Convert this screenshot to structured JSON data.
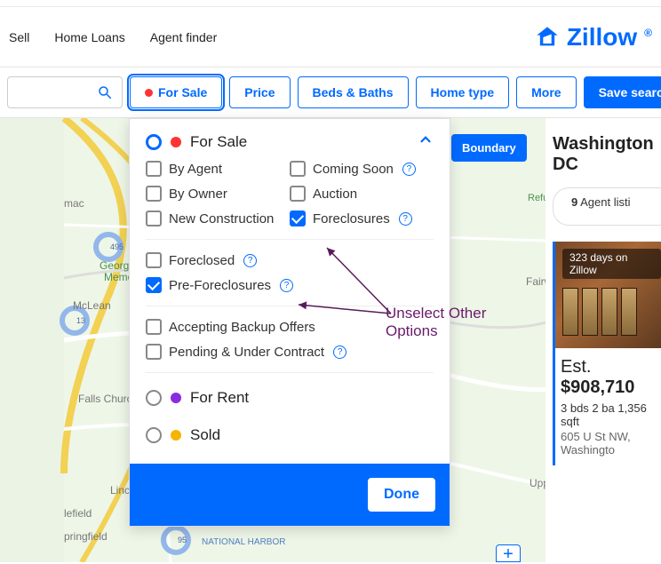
{
  "nav": {
    "sell": "Sell",
    "homeLoans": "Home Loans",
    "agentFinder": "Agent finder",
    "brand": "Zillow"
  },
  "filters": {
    "forSale": "For Sale",
    "price": "Price",
    "bedsBaths": "Beds & Baths",
    "homeType": "Home type",
    "more": "More",
    "saveSearch": "Save search"
  },
  "map": {
    "boundary": "Boundary"
  },
  "dropdown": {
    "forSale": "For Sale",
    "byAgent": "By Agent",
    "byOwner": "By Owner",
    "newConstruction": "New Construction",
    "comingSoon": "Coming Soon",
    "auction": "Auction",
    "foreclosures": "Foreclosures",
    "foreclosed": "Foreclosed",
    "preForeclosures": "Pre-Foreclosures",
    "backupOffers": "Accepting Backup Offers",
    "pendingContract": "Pending & Under Contract",
    "forRent": "For Rent",
    "sold": "Sold",
    "done": "Done"
  },
  "right": {
    "city": "Washington DC",
    "count": "9",
    "countLabel": "Agent listi",
    "badge": "323 days on Zillow",
    "pricePrefix": "Est.",
    "price": "$908,710",
    "meta": "3 bds  2 ba  1,356 sqft",
    "addr": "605 U St NW, Washingto"
  },
  "annotation": {
    "line1": "Unselect Other",
    "line2": "Options"
  },
  "colors": {
    "forSaleDot": "#f33",
    "forRentDot": "#8a2be2",
    "soldDot": "#f5b400"
  }
}
